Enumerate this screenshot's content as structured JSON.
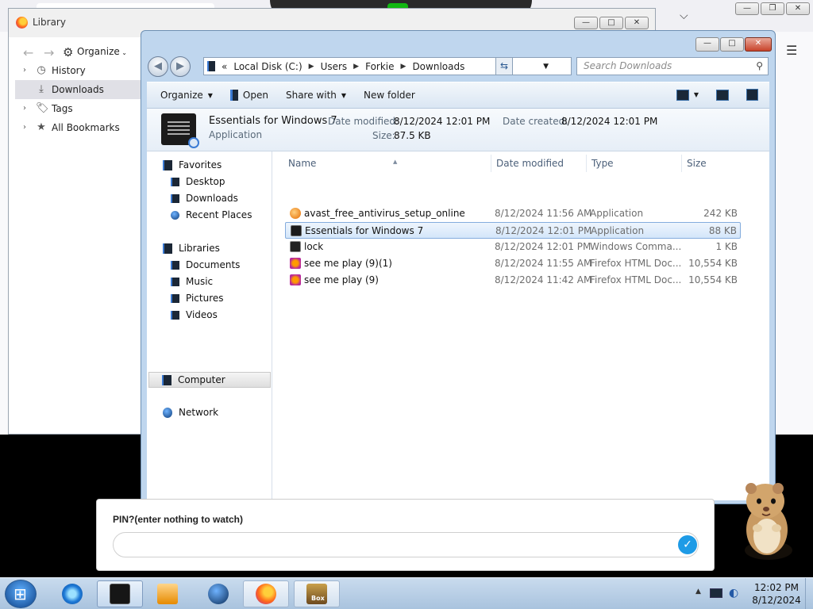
{
  "library": {
    "title": "Library",
    "organize_label": "Organize",
    "tree": [
      {
        "label": "History",
        "icon": "clock-icon",
        "expandable": true
      },
      {
        "label": "Downloads",
        "icon": "download-icon",
        "expandable": false,
        "selected": true
      },
      {
        "label": "Tags",
        "icon": "tag-icon",
        "expandable": true
      },
      {
        "label": "All Bookmarks",
        "icon": "star-icon",
        "expandable": true
      }
    ]
  },
  "explorer": {
    "address": {
      "prefix": "«",
      "crumbs": [
        "Local Disk (C:)",
        "Users",
        "Forkie",
        "Downloads"
      ]
    },
    "search_placeholder": "Search Downloads",
    "toolbar": {
      "organize": "Organize",
      "open": "Open",
      "share_with": "Share with",
      "new_folder": "New folder"
    },
    "details": {
      "name": "Essentials for Windows 7",
      "type": "Application",
      "modified_label": "Date modified:",
      "modified_value": "8/12/2024 12:01 PM",
      "created_label": "Date created:",
      "created_value": "8/12/2024 12:01 PM",
      "size_label": "Size:",
      "size_value": "87.5 KB"
    },
    "nav": {
      "favorites": "Favorites",
      "desktop": "Desktop",
      "downloads": "Downloads",
      "recent": "Recent Places",
      "libraries": "Libraries",
      "documents": "Documents",
      "music": "Music",
      "pictures": "Pictures",
      "videos": "Videos",
      "computer": "Computer",
      "network": "Network"
    },
    "columns": {
      "name": "Name",
      "modified": "Date modified",
      "type": "Type",
      "size": "Size"
    },
    "files": [
      {
        "name": "avast_free_antivirus_setup_online",
        "modified": "8/12/2024 11:56 AM",
        "type": "Application",
        "size": "242 KB",
        "icon": "avast-icon"
      },
      {
        "name": "Essentials for Windows 7",
        "modified": "8/12/2024 12:01 PM",
        "type": "Application",
        "size": "88 KB",
        "icon": "app-icon",
        "selected": true
      },
      {
        "name": "lock",
        "modified": "8/12/2024 12:01 PM",
        "type": "Windows Comma...",
        "size": "1 KB",
        "icon": "cmd-icon"
      },
      {
        "name": "see me play (9)(1)",
        "modified": "8/12/2024 11:55 AM",
        "type": "Firefox HTML Doc...",
        "size": "10,554 KB",
        "icon": "html-icon"
      },
      {
        "name": "see me play (9)",
        "modified": "8/12/2024 11:42 AM",
        "type": "Firefox HTML Doc...",
        "size": "10,554 KB",
        "icon": "html-icon"
      }
    ]
  },
  "pin": {
    "label": "PIN?(enter nothing to watch)",
    "value": ""
  },
  "taskbar": {
    "time": "12:02 PM",
    "date": "8/12/2024",
    "box_label": "Box"
  },
  "colors": {
    "explorer_frame": "#bfd6ee",
    "selection": "#d4e6fa",
    "pin_accent": "#1e9be6"
  }
}
